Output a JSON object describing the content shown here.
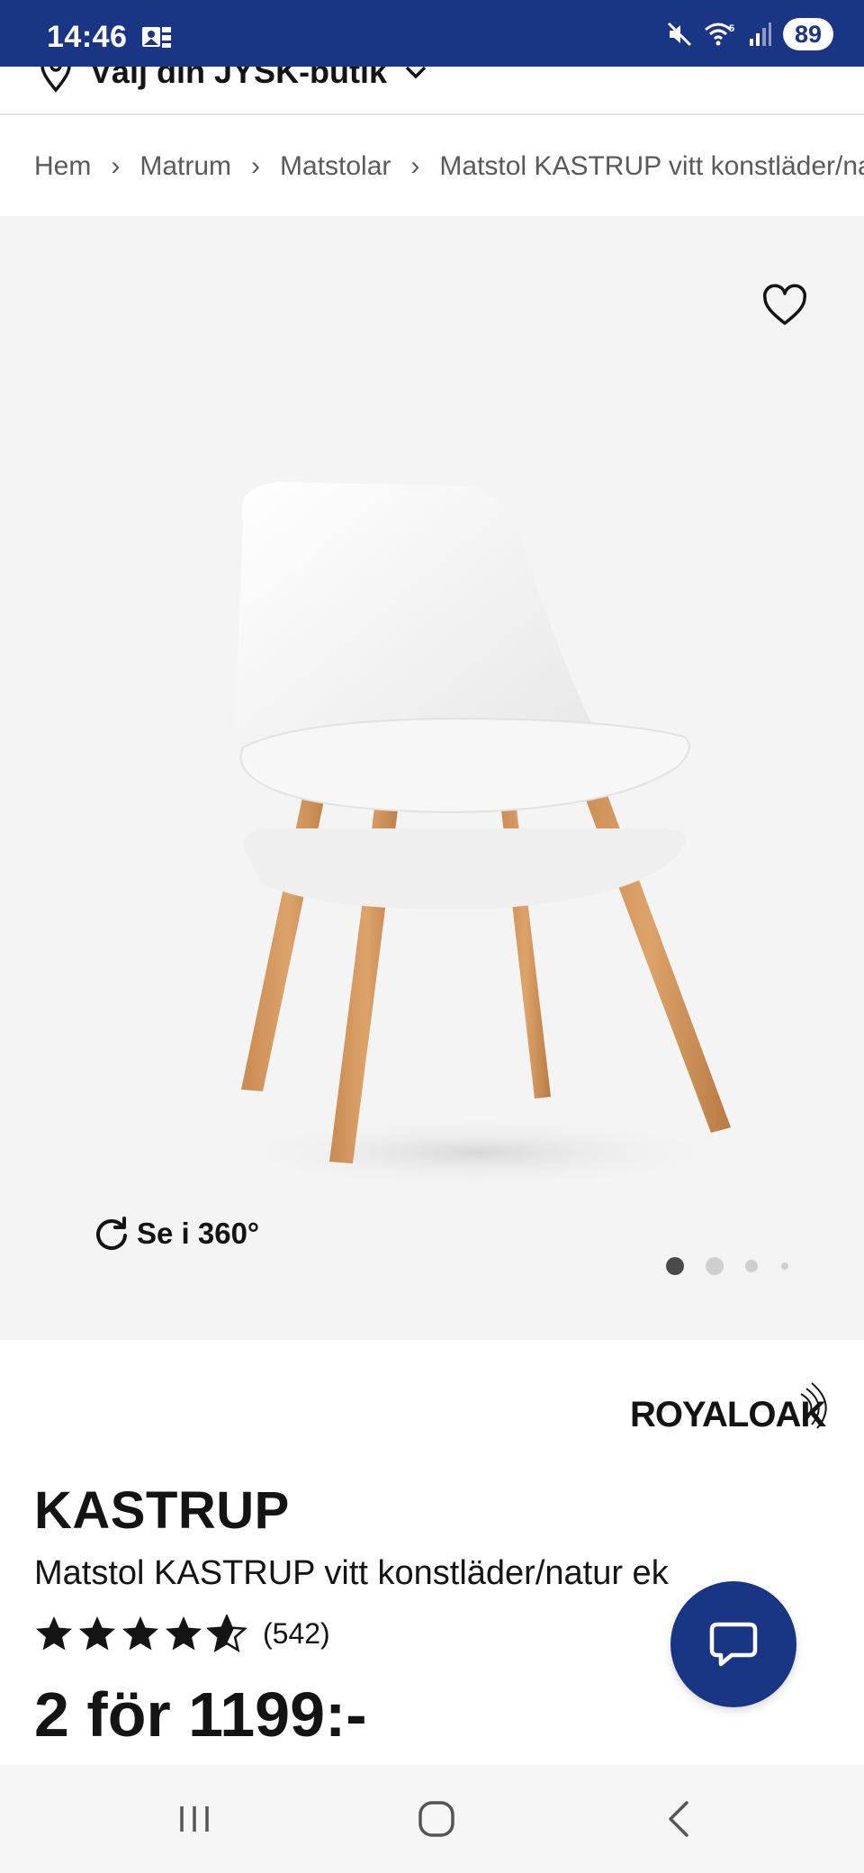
{
  "status_bar": {
    "time": "14:46",
    "battery": "89",
    "icons": [
      "photo-gallery-icon",
      "mute-icon",
      "wifi-5-icon",
      "signal-icon"
    ]
  },
  "store_selector": {
    "label": "Välj din JYSK-butik",
    "icon": "location-pin-icon"
  },
  "breadcrumb": {
    "items": [
      "Hem",
      "Matrum",
      "Matstolar",
      "Matstol KASTRUP vitt konstläder/natur ek"
    ],
    "separator": "›"
  },
  "gallery": {
    "view_360_label": "Se i 360°",
    "slide_count": 4,
    "active_slide": 1,
    "favorite_icon": "heart-icon"
  },
  "product": {
    "brand": "ROYALOAK",
    "name": "KASTRUP",
    "subtitle": "Matstol KASTRUP vitt konstläder/natur ek",
    "rating": 4.5,
    "review_count": "(542)",
    "price": "2 för 1199:-"
  },
  "chat": {
    "icon": "chat-bubble-icon"
  },
  "colors": {
    "brand_blue": "#1b3585",
    "gallery_bg": "#f4f4f4",
    "text": "#141414"
  }
}
